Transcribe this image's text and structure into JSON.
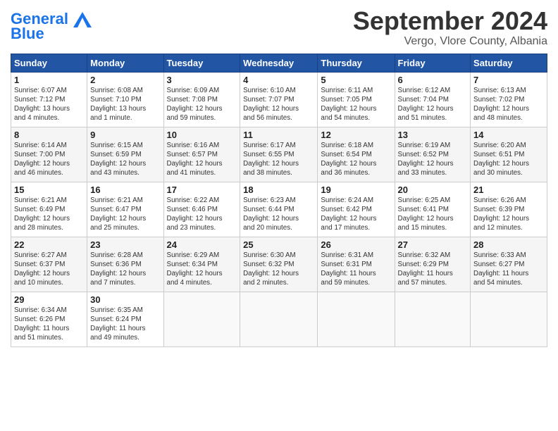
{
  "header": {
    "logo_line1": "General",
    "logo_line2": "Blue",
    "month_title": "September 2024",
    "subtitle": "Vergo, Vlore County, Albania"
  },
  "weekdays": [
    "Sunday",
    "Monday",
    "Tuesday",
    "Wednesday",
    "Thursday",
    "Friday",
    "Saturday"
  ],
  "weeks": [
    [
      {
        "day": "1",
        "info": "Sunrise: 6:07 AM\nSunset: 7:12 PM\nDaylight: 13 hours\nand 4 minutes."
      },
      {
        "day": "2",
        "info": "Sunrise: 6:08 AM\nSunset: 7:10 PM\nDaylight: 13 hours\nand 1 minute."
      },
      {
        "day": "3",
        "info": "Sunrise: 6:09 AM\nSunset: 7:08 PM\nDaylight: 12 hours\nand 59 minutes."
      },
      {
        "day": "4",
        "info": "Sunrise: 6:10 AM\nSunset: 7:07 PM\nDaylight: 12 hours\nand 56 minutes."
      },
      {
        "day": "5",
        "info": "Sunrise: 6:11 AM\nSunset: 7:05 PM\nDaylight: 12 hours\nand 54 minutes."
      },
      {
        "day": "6",
        "info": "Sunrise: 6:12 AM\nSunset: 7:04 PM\nDaylight: 12 hours\nand 51 minutes."
      },
      {
        "day": "7",
        "info": "Sunrise: 6:13 AM\nSunset: 7:02 PM\nDaylight: 12 hours\nand 48 minutes."
      }
    ],
    [
      {
        "day": "8",
        "info": "Sunrise: 6:14 AM\nSunset: 7:00 PM\nDaylight: 12 hours\nand 46 minutes."
      },
      {
        "day": "9",
        "info": "Sunrise: 6:15 AM\nSunset: 6:59 PM\nDaylight: 12 hours\nand 43 minutes."
      },
      {
        "day": "10",
        "info": "Sunrise: 6:16 AM\nSunset: 6:57 PM\nDaylight: 12 hours\nand 41 minutes."
      },
      {
        "day": "11",
        "info": "Sunrise: 6:17 AM\nSunset: 6:55 PM\nDaylight: 12 hours\nand 38 minutes."
      },
      {
        "day": "12",
        "info": "Sunrise: 6:18 AM\nSunset: 6:54 PM\nDaylight: 12 hours\nand 36 minutes."
      },
      {
        "day": "13",
        "info": "Sunrise: 6:19 AM\nSunset: 6:52 PM\nDaylight: 12 hours\nand 33 minutes."
      },
      {
        "day": "14",
        "info": "Sunrise: 6:20 AM\nSunset: 6:51 PM\nDaylight: 12 hours\nand 30 minutes."
      }
    ],
    [
      {
        "day": "15",
        "info": "Sunrise: 6:21 AM\nSunset: 6:49 PM\nDaylight: 12 hours\nand 28 minutes."
      },
      {
        "day": "16",
        "info": "Sunrise: 6:21 AM\nSunset: 6:47 PM\nDaylight: 12 hours\nand 25 minutes."
      },
      {
        "day": "17",
        "info": "Sunrise: 6:22 AM\nSunset: 6:46 PM\nDaylight: 12 hours\nand 23 minutes."
      },
      {
        "day": "18",
        "info": "Sunrise: 6:23 AM\nSunset: 6:44 PM\nDaylight: 12 hours\nand 20 minutes."
      },
      {
        "day": "19",
        "info": "Sunrise: 6:24 AM\nSunset: 6:42 PM\nDaylight: 12 hours\nand 17 minutes."
      },
      {
        "day": "20",
        "info": "Sunrise: 6:25 AM\nSunset: 6:41 PM\nDaylight: 12 hours\nand 15 minutes."
      },
      {
        "day": "21",
        "info": "Sunrise: 6:26 AM\nSunset: 6:39 PM\nDaylight: 12 hours\nand 12 minutes."
      }
    ],
    [
      {
        "day": "22",
        "info": "Sunrise: 6:27 AM\nSunset: 6:37 PM\nDaylight: 12 hours\nand 10 minutes."
      },
      {
        "day": "23",
        "info": "Sunrise: 6:28 AM\nSunset: 6:36 PM\nDaylight: 12 hours\nand 7 minutes."
      },
      {
        "day": "24",
        "info": "Sunrise: 6:29 AM\nSunset: 6:34 PM\nDaylight: 12 hours\nand 4 minutes."
      },
      {
        "day": "25",
        "info": "Sunrise: 6:30 AM\nSunset: 6:32 PM\nDaylight: 12 hours\nand 2 minutes."
      },
      {
        "day": "26",
        "info": "Sunrise: 6:31 AM\nSunset: 6:31 PM\nDaylight: 11 hours\nand 59 minutes."
      },
      {
        "day": "27",
        "info": "Sunrise: 6:32 AM\nSunset: 6:29 PM\nDaylight: 11 hours\nand 57 minutes."
      },
      {
        "day": "28",
        "info": "Sunrise: 6:33 AM\nSunset: 6:27 PM\nDaylight: 11 hours\nand 54 minutes."
      }
    ],
    [
      {
        "day": "29",
        "info": "Sunrise: 6:34 AM\nSunset: 6:26 PM\nDaylight: 11 hours\nand 51 minutes."
      },
      {
        "day": "30",
        "info": "Sunrise: 6:35 AM\nSunset: 6:24 PM\nDaylight: 11 hours\nand 49 minutes."
      },
      {
        "day": "",
        "info": ""
      },
      {
        "day": "",
        "info": ""
      },
      {
        "day": "",
        "info": ""
      },
      {
        "day": "",
        "info": ""
      },
      {
        "day": "",
        "info": ""
      }
    ]
  ]
}
